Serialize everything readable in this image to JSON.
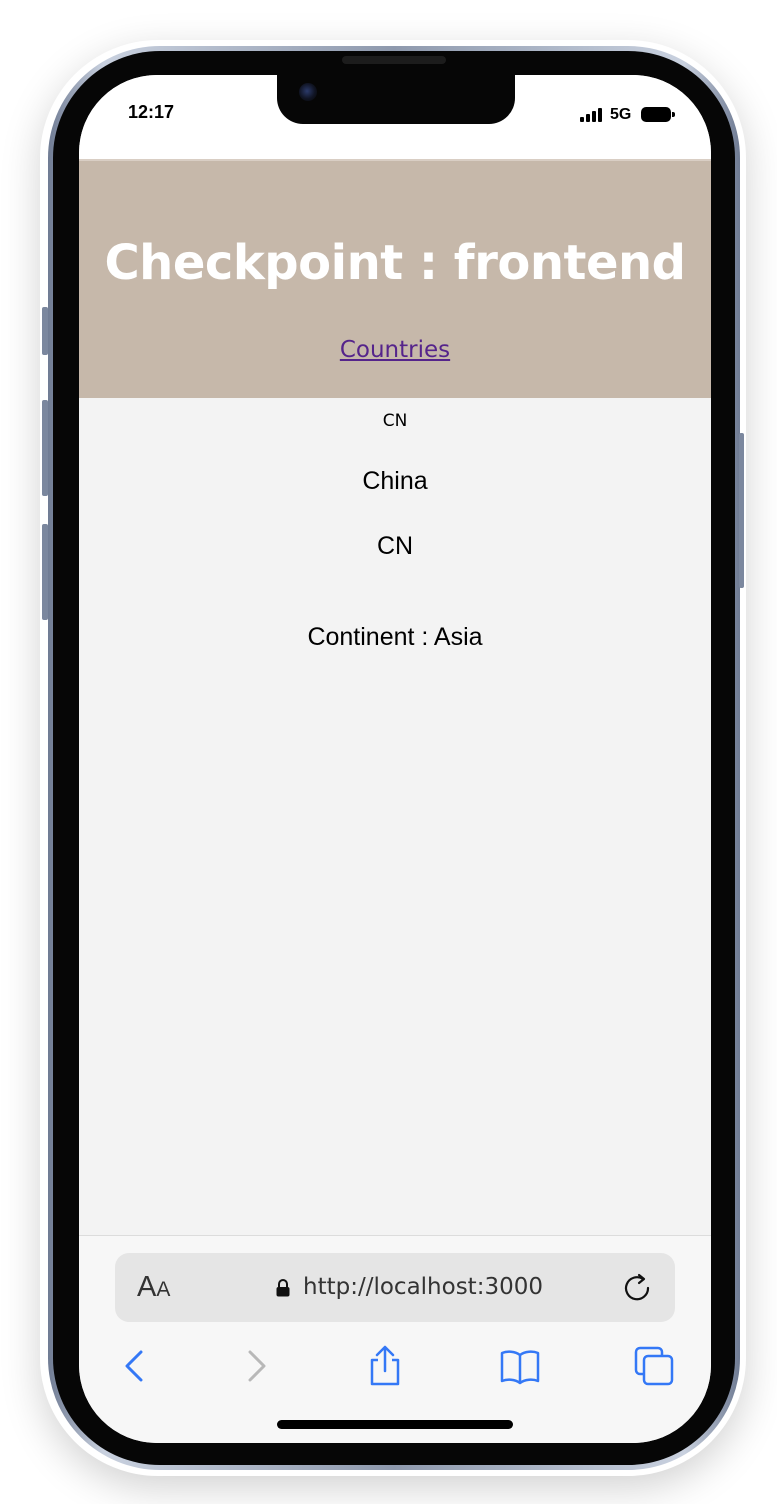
{
  "status_bar": {
    "time": "12:17",
    "network": "5G"
  },
  "header": {
    "title": "Checkpoint : frontend",
    "nav_link": "Countries"
  },
  "country": {
    "flag_code": "CN",
    "name": "China",
    "code": "CN",
    "continent": "Continent : Asia"
  },
  "browser": {
    "text_size_label_large": "A",
    "text_size_label_small": "A",
    "url": "http://localhost:3000"
  },
  "colors": {
    "header_bg": "#c6b8aa",
    "link": "#55248b",
    "toolbar_accent": "#3478f6",
    "page_bg": "#f3f3f3"
  },
  "icons": [
    "signal-icon",
    "battery-icon",
    "lock-icon",
    "reload-icon",
    "back-icon",
    "forward-icon",
    "share-icon",
    "bookmarks-icon",
    "tabs-icon"
  ]
}
